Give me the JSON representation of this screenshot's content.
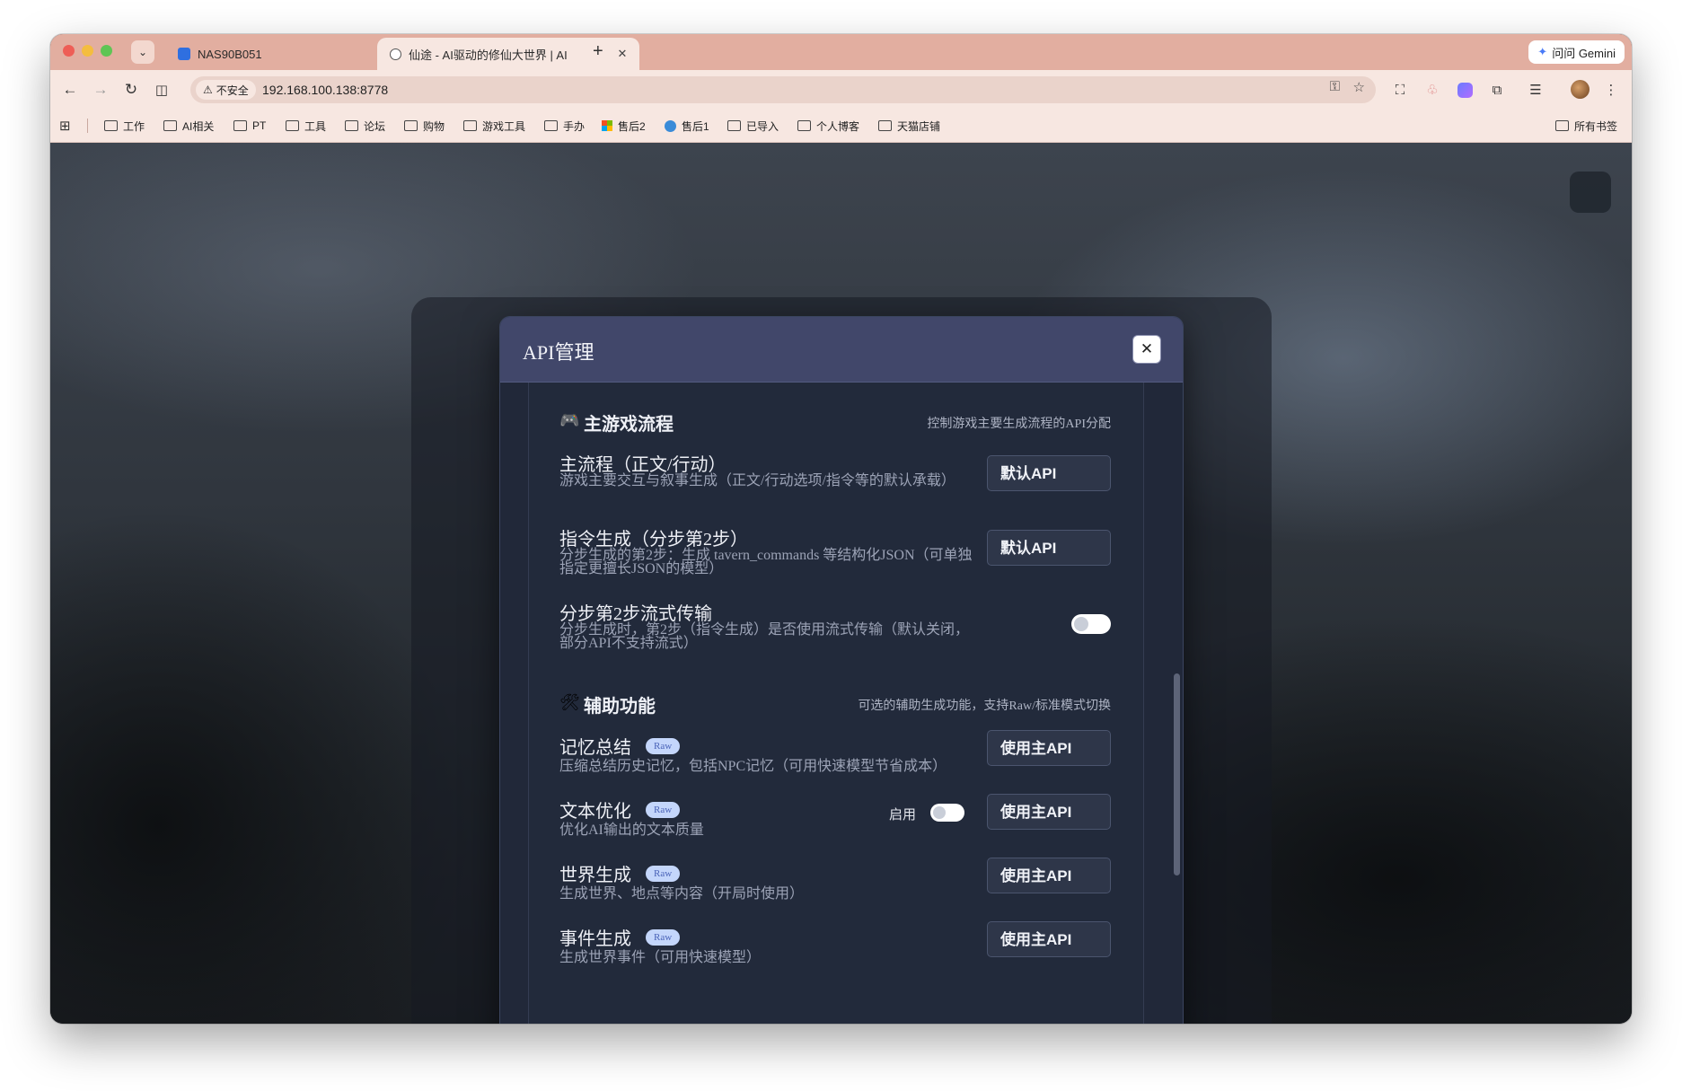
{
  "browser": {
    "tabs": [
      {
        "title": "NAS90B051"
      },
      {
        "title": "仙途 - AI驱动的修仙大世界 | AI"
      }
    ],
    "gemini_label": "问问 Gemini",
    "security_label": "不安全",
    "url": "192.168.100.138:8778",
    "bookmarks": [
      "工作",
      "AI相关",
      "PT",
      "工具",
      "论坛",
      "购物",
      "游戏工具",
      "手办",
      "售后2",
      "售后1",
      "已导入",
      "个人博客",
      "天猫店铺"
    ],
    "all_bookmarks_label": "所有书签"
  },
  "modal": {
    "title": "API管理",
    "sections": [
      {
        "icon": "🎮",
        "title": "主游戏流程",
        "desc": "控制游戏主要生成流程的API分配",
        "rows": [
          {
            "title": "主流程（正文/行动）",
            "desc": "游戏主要交互与叙事生成（正文/行动选项/指令等的默认承载）",
            "button": "默认API"
          },
          {
            "title": "指令生成（分步第2步）",
            "desc": "分步生成的第2步：生成 tavern_commands 等结构化JSON（可单独指定更擅长JSON的模型）",
            "button": "默认API"
          },
          {
            "title": "分步第2步流式传输",
            "desc": "分步生成时，第2步（指令生成）是否使用流式传输（默认关闭，部分API不支持流式）",
            "toggle_on": false
          }
        ]
      },
      {
        "icon": "🛠",
        "title": "辅助功能",
        "desc": "可选的辅助生成功能，支持Raw/标准模式切换",
        "rows": [
          {
            "title": "记忆总结",
            "badge": "Raw",
            "desc": "压缩总结历史记忆，包括NPC记忆（可用快速模型节省成本）",
            "button": "使用主API"
          },
          {
            "title": "文本优化",
            "badge": "Raw",
            "desc": "优化AI输出的文本质量",
            "toggle_label": "启用",
            "toggle_on": false,
            "button": "使用主API"
          },
          {
            "title": "世界生成",
            "badge": "Raw",
            "desc": "生成世界、地点等内容（开局时使用）",
            "button": "使用主API"
          },
          {
            "title": "事件生成",
            "badge": "Raw",
            "desc": "生成世界事件（可用快速模型）",
            "button": "使用主API"
          }
        ]
      }
    ]
  }
}
